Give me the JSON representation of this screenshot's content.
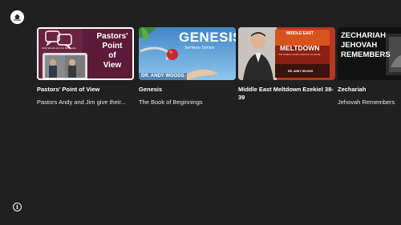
{
  "app": {
    "logo_icon": "church-logo-icon"
  },
  "cards": [
    {
      "title": "Pastors' Point of View",
      "subtitle": "Pastors Andy and Jim give their...",
      "thumb_text_lines": [
        "Pastors'",
        "Point",
        "of",
        "View"
      ],
      "thumb_caption": "Andy Woods and Jim McGowan",
      "accent": "#6b1f3a",
      "focused": true
    },
    {
      "title": "Genesis",
      "subtitle": "The Book of Beginnings",
      "thumb_heading": "GENESIS",
      "thumb_subheading": "Sermon Series",
      "thumb_author": "DR. ANDY WOODS",
      "accent": "#4a8fc4",
      "focused": false
    },
    {
      "title": "Middle East Meltdown Ezekiel 38-39",
      "subtitle": "",
      "thumb_book_top": "MIDDLE EAST",
      "thumb_book_title": "MELTDOWN",
      "thumb_book_sub": "THE COMING ISLAMIC INVASION OF ISRAEL",
      "thumb_book_author": "DR. ANDY WOODS",
      "accent": "#c0392b",
      "focused": false
    },
    {
      "title": "Zechariah",
      "subtitle": "Jehovah Remembers",
      "thumb_heading_lines": [
        "ZECHARIAH",
        "JEHOVAH",
        "REMEMBERS"
      ],
      "accent": "#111111",
      "focused": false
    }
  ],
  "footer": {
    "info_icon": "info-icon",
    "info_glyph": "i"
  }
}
